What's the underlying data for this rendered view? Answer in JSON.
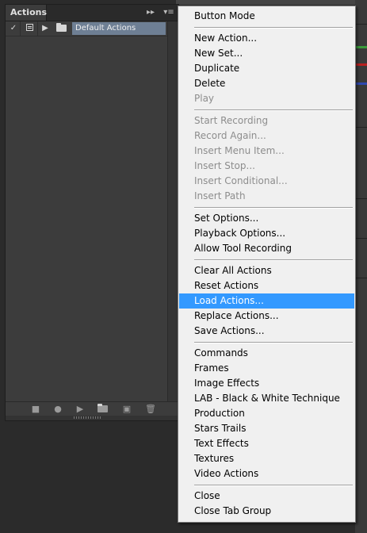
{
  "panel": {
    "tab_label": "Actions",
    "collapse_glyph": "▸▸",
    "menu_glyph": "▾≡",
    "rows": [
      {
        "checked": true,
        "check_glyph": "✓",
        "expand_glyph": "▶",
        "name": "Default Actions",
        "selected": true
      }
    ],
    "toolbar": {
      "stop_glyph": "■",
      "record_glyph": "●",
      "play_glyph": "▶",
      "new_set_glyph": "▬",
      "new_action_glyph": "▣",
      "delete_glyph": "🗑"
    }
  },
  "menu": {
    "groups": [
      [
        {
          "label": "Button Mode",
          "enabled": true
        }
      ],
      [
        {
          "label": "New Action...",
          "enabled": true
        },
        {
          "label": "New Set...",
          "enabled": true
        },
        {
          "label": "Duplicate",
          "enabled": true
        },
        {
          "label": "Delete",
          "enabled": true
        },
        {
          "label": "Play",
          "enabled": false
        }
      ],
      [
        {
          "label": "Start Recording",
          "enabled": false
        },
        {
          "label": "Record Again...",
          "enabled": false
        },
        {
          "label": "Insert Menu Item...",
          "enabled": false
        },
        {
          "label": "Insert Stop...",
          "enabled": false
        },
        {
          "label": "Insert Conditional...",
          "enabled": false
        },
        {
          "label": "Insert Path",
          "enabled": false
        }
      ],
      [
        {
          "label": "Set Options...",
          "enabled": true
        },
        {
          "label": "Playback Options...",
          "enabled": true
        },
        {
          "label": "Allow Tool Recording",
          "enabled": true
        }
      ],
      [
        {
          "label": "Clear All Actions",
          "enabled": true
        },
        {
          "label": "Reset Actions",
          "enabled": true
        },
        {
          "label": "Load Actions...",
          "enabled": true,
          "highlighted": true
        },
        {
          "label": "Replace Actions...",
          "enabled": true
        },
        {
          "label": "Save Actions...",
          "enabled": true
        }
      ],
      [
        {
          "label": "Commands",
          "enabled": true
        },
        {
          "label": "Frames",
          "enabled": true
        },
        {
          "label": "Image Effects",
          "enabled": true
        },
        {
          "label": "LAB - Black & White Technique",
          "enabled": true
        },
        {
          "label": "Production",
          "enabled": true
        },
        {
          "label": "Stars Trails",
          "enabled": true
        },
        {
          "label": "Text Effects",
          "enabled": true
        },
        {
          "label": "Textures",
          "enabled": true
        },
        {
          "label": "Video Actions",
          "enabled": true
        }
      ],
      [
        {
          "label": "Close",
          "enabled": true
        },
        {
          "label": "Close Tab Group",
          "enabled": true
        }
      ]
    ]
  },
  "colors": {
    "highlight": "#3399ff",
    "selected_row": "#6e7f94",
    "disabled_text": "#8d8d8d"
  }
}
